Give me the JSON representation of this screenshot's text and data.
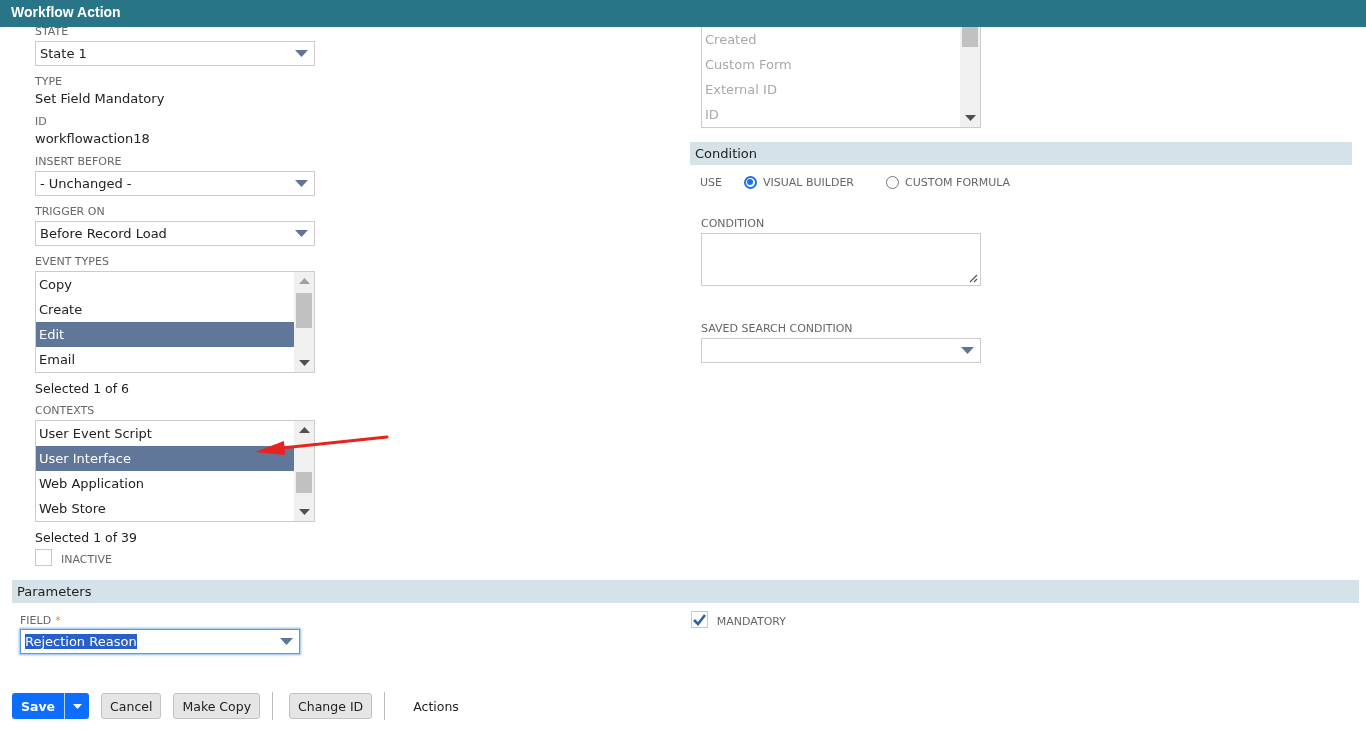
{
  "window": {
    "title": "Workflow Action"
  },
  "left_fields": [
    {
      "kind": "select",
      "label": "STATE",
      "value": "State 1"
    },
    {
      "kind": "text",
      "label": "TYPE",
      "value": "Set Field Mandatory"
    },
    {
      "kind": "text",
      "label": "ID",
      "value": "workflowaction18"
    },
    {
      "kind": "select",
      "label": "INSERT BEFORE",
      "value": "- Unchanged -"
    },
    {
      "kind": "select",
      "label": "TRIGGER ON",
      "value": "Before Record Load"
    },
    {
      "kind": "listbox",
      "label": "EVENT TYPES",
      "count": "Selected 1 of 6",
      "items": [
        {
          "label": "Copy",
          "selected": false
        },
        {
          "label": "Create",
          "selected": false
        },
        {
          "label": "Edit",
          "selected": true
        },
        {
          "label": "Email",
          "selected": false
        }
      ]
    },
    {
      "kind": "listbox",
      "label": "CONTEXTS",
      "count": "Selected 1 of 39",
      "items": [
        {
          "label": "User Event Script",
          "selected": false
        },
        {
          "label": "User Interface",
          "selected": true
        },
        {
          "label": "Web Application",
          "selected": false
        },
        {
          "label": "Web Store",
          "selected": false
        }
      ]
    },
    {
      "kind": "checkbox",
      "label": "INACTIVE",
      "checked": false
    }
  ],
  "field_list": {
    "disabled": true,
    "items": [
      {
        "label": "Created",
        "selected": false
      },
      {
        "label": "Custom Form",
        "selected": false
      },
      {
        "label": "External ID",
        "selected": false
      },
      {
        "label": "ID",
        "selected": false
      }
    ]
  },
  "condition": {
    "title": "Condition",
    "use_label": "USE",
    "options": [
      {
        "label": "VISUAL BUILDER",
        "selected": true
      },
      {
        "label": "CUSTOM FORMULA",
        "selected": false
      }
    ],
    "condition_label": "CONDITION",
    "saved_search_label": "SAVED SEARCH CONDITION"
  },
  "parameters": {
    "title": "Parameters",
    "field": {
      "label": "FIELD",
      "required_mark": "*",
      "value": "Rejection Reason"
    },
    "mandatory": {
      "label": "MANDATORY",
      "checked": true
    }
  },
  "buttons": [
    {
      "kind": "split",
      "label": "Save"
    },
    {
      "kind": "plain",
      "label": "Cancel"
    },
    {
      "kind": "plain",
      "label": "Make Copy"
    },
    {
      "kind": "separator"
    },
    {
      "kind": "plain",
      "label": "Change ID"
    },
    {
      "kind": "separator"
    },
    {
      "kind": "text",
      "label": "Actions"
    }
  ]
}
